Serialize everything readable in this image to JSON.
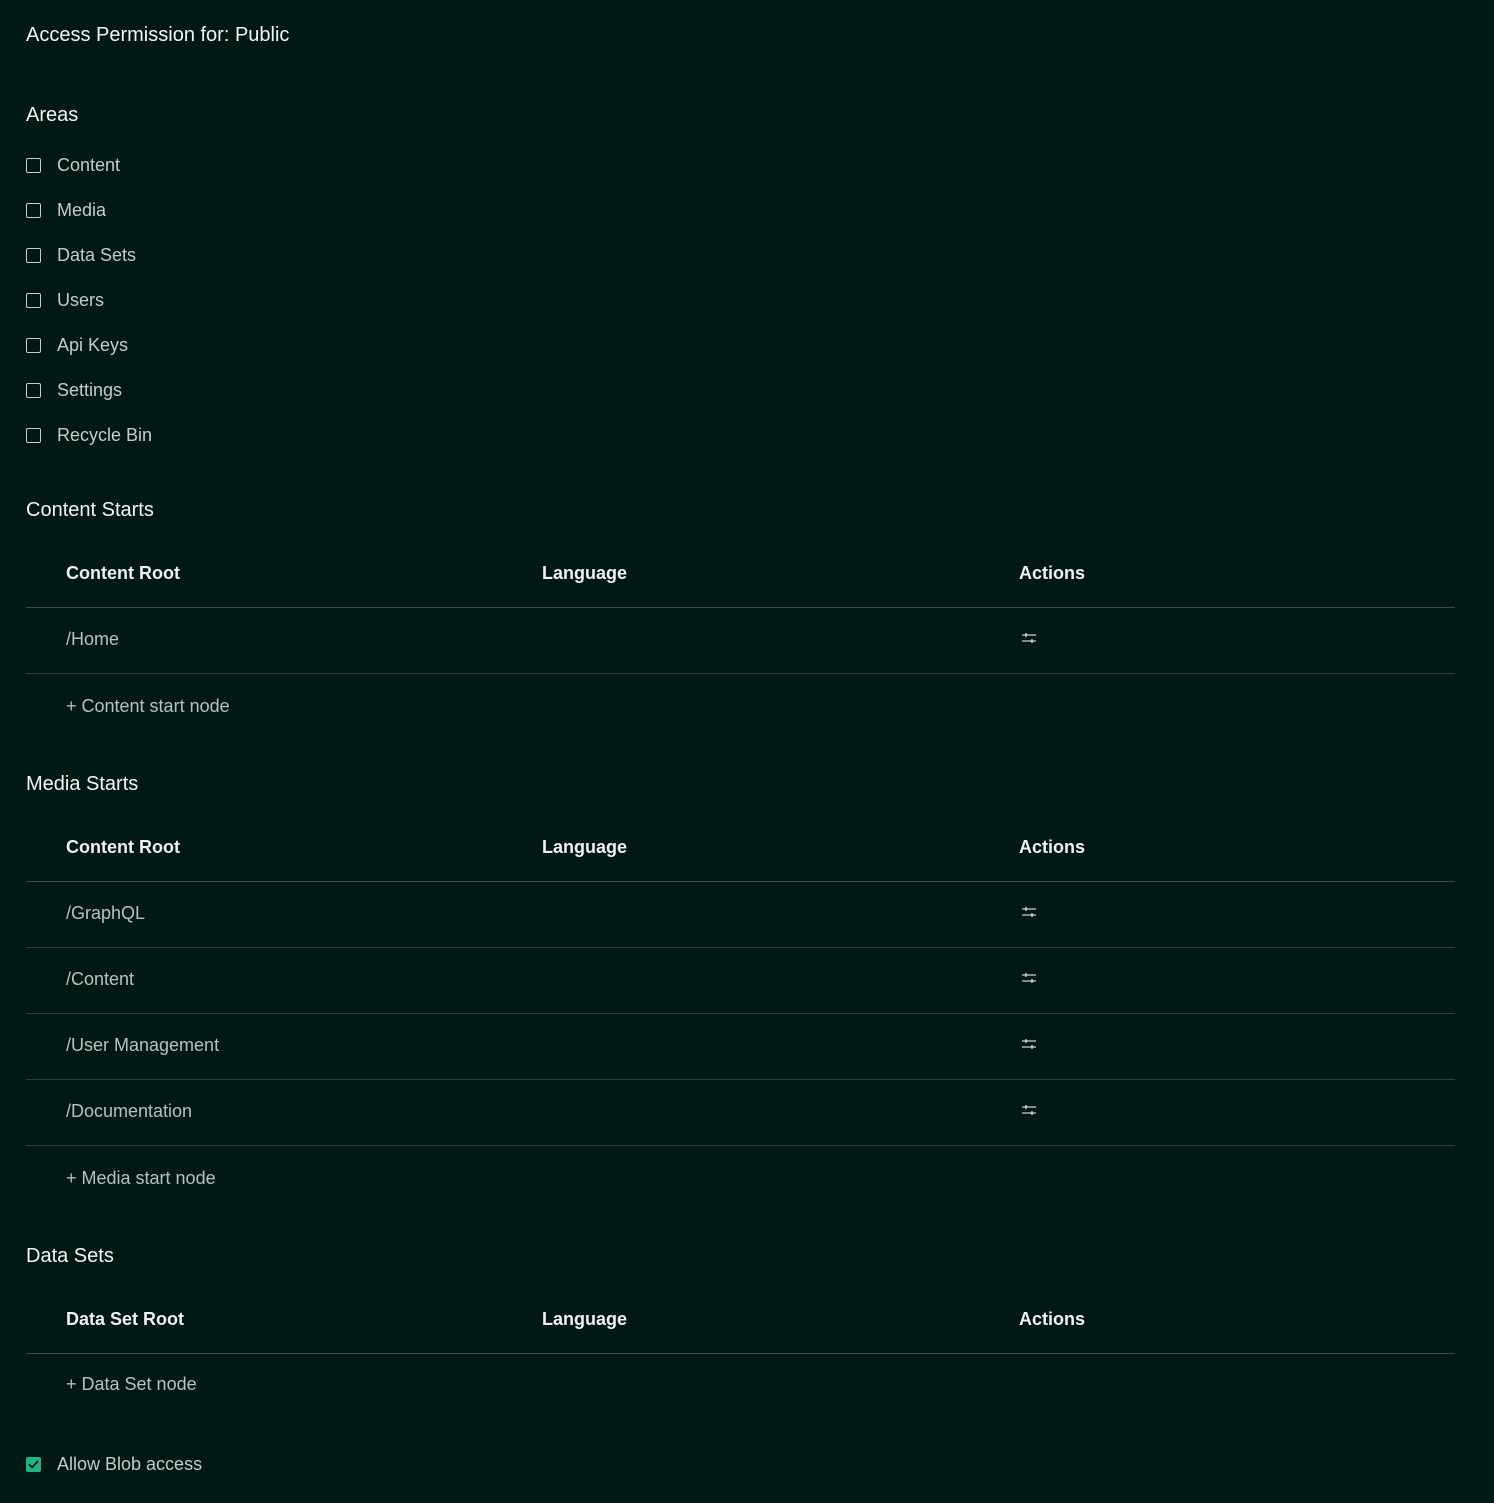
{
  "page": {
    "title": "Access Permission for: Public"
  },
  "areas": {
    "title": "Areas",
    "items": [
      {
        "label": "Content",
        "checked": false
      },
      {
        "label": "Media",
        "checked": false
      },
      {
        "label": "Data Sets",
        "checked": false
      },
      {
        "label": "Users",
        "checked": false
      },
      {
        "label": "Api Keys",
        "checked": false
      },
      {
        "label": "Settings",
        "checked": false
      },
      {
        "label": "Recycle Bin",
        "checked": false
      }
    ]
  },
  "content_starts": {
    "title": "Content Starts",
    "columns": [
      "Content Root",
      "Language",
      "Actions"
    ],
    "rows": [
      {
        "root": "/Home",
        "language": "",
        "action_icon": "sliders-icon"
      }
    ],
    "add_label": "+ Content start node"
  },
  "media_starts": {
    "title": "Media Starts",
    "columns": [
      "Content Root",
      "Language",
      "Actions"
    ],
    "rows": [
      {
        "root": "/GraphQL",
        "language": "",
        "action_icon": "sliders-icon"
      },
      {
        "root": "/Content",
        "language": "",
        "action_icon": "sliders-icon"
      },
      {
        "root": "/User Management",
        "language": "",
        "action_icon": "sliders-icon"
      },
      {
        "root": "/Documentation",
        "language": "",
        "action_icon": "sliders-icon"
      }
    ],
    "add_label": "+ Media start node"
  },
  "data_sets": {
    "title": "Data Sets",
    "columns": [
      "Data Set Root",
      "Language",
      "Actions"
    ],
    "rows": [],
    "add_label": "+ Data Set node"
  },
  "blob_access": {
    "label": "Allow Blob access",
    "checked": true
  },
  "colors": {
    "background": "#011816",
    "accent": "#23b484"
  }
}
